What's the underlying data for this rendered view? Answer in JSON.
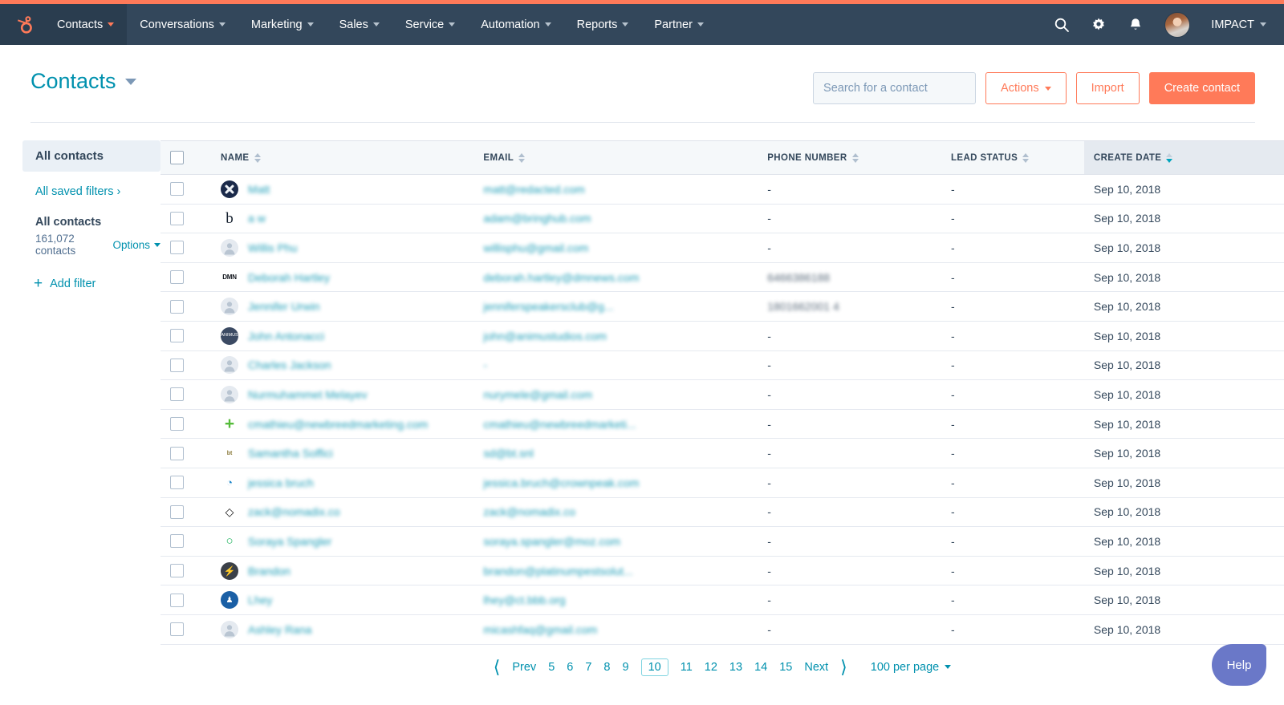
{
  "brand": {
    "accent": "#ff7a59",
    "nav_bg": "#33475b",
    "link": "#0091ae",
    "help_bg": "#6a78c8"
  },
  "nav": {
    "logo": "hubspot-logo",
    "items": [
      {
        "label": "Contacts",
        "active": true
      },
      {
        "label": "Conversations",
        "active": false
      },
      {
        "label": "Marketing",
        "active": false
      },
      {
        "label": "Sales",
        "active": false
      },
      {
        "label": "Service",
        "active": false
      },
      {
        "label": "Automation",
        "active": false
      },
      {
        "label": "Reports",
        "active": false
      },
      {
        "label": "Partner",
        "active": false
      }
    ],
    "icons": [
      "search-icon",
      "gear-icon",
      "bell-icon"
    ],
    "account": "IMPACT"
  },
  "header": {
    "title": "Contacts",
    "search": {
      "value": "",
      "placeholder": "Search for a contact"
    },
    "actions_label": "Actions",
    "import_label": "Import",
    "create_label": "Create contact"
  },
  "sidebar": {
    "tab": "All contacts",
    "saved_filters": "All saved filters",
    "group_title": "All contacts",
    "contact_count": "161,072 contacts",
    "options_label": "Options",
    "add_filter": "Add filter"
  },
  "table": {
    "columns": [
      {
        "label": "NAME",
        "sorted": false
      },
      {
        "label": "EMAIL",
        "sorted": false
      },
      {
        "label": "PHONE NUMBER",
        "sorted": false
      },
      {
        "label": "LEAD STATUS",
        "sorted": false
      },
      {
        "label": "CREATE DATE",
        "sorted": true,
        "direction": "desc"
      }
    ],
    "rows": [
      {
        "avatar": "x-logo-icon",
        "name": "Matt",
        "email": "matt@redacted.com",
        "phone": "-",
        "lead_status": "-",
        "create_date": "Sep 10, 2018"
      },
      {
        "avatar": "b-logo-icon",
        "name": "a w",
        "email": "adam@bringhub.com",
        "phone": "-",
        "lead_status": "-",
        "create_date": "Sep 10, 2018"
      },
      {
        "avatar": "default-avatar-icon",
        "name": "Willis Phu",
        "email": "willisphu@gmail.com",
        "phone": "-",
        "lead_status": "-",
        "create_date": "Sep 10, 2018"
      },
      {
        "avatar": "dmn-logo-icon",
        "name": "Deborah Hartley",
        "email": "deborah.hartley@dmnews.com",
        "phone": "6466386188",
        "lead_status": "-",
        "create_date": "Sep 10, 2018"
      },
      {
        "avatar": "default-avatar-icon",
        "name": "Jennifer Urwin",
        "email": "jenniferspeakersclub@g...",
        "phone": "1801662001 4",
        "lead_status": "-",
        "create_date": "Sep 10, 2018"
      },
      {
        "avatar": "animus-logo-icon",
        "name": "John Antonacci",
        "email": "john@animustudios.com",
        "phone": "-",
        "lead_status": "-",
        "create_date": "Sep 10, 2018"
      },
      {
        "avatar": "default-avatar-icon",
        "name": "Charles Jackson",
        "email": "-",
        "phone": "-",
        "lead_status": "-",
        "create_date": "Sep 10, 2018"
      },
      {
        "avatar": "default-avatar-icon",
        "name": "Nurmuhammet Melayev",
        "email": "nurymele@gmail.com",
        "phone": "-",
        "lead_status": "-",
        "create_date": "Sep 10, 2018"
      },
      {
        "avatar": "plus-logo-icon",
        "name": "cmathieu@newbreedmarketing.com",
        "email": "cmathieu@newbreedmarketi...",
        "phone": "-",
        "lead_status": "-",
        "create_date": "Sep 10, 2018"
      },
      {
        "avatar": "bt-logo-icon",
        "name": "Samantha Soffici",
        "email": "sd@bt.snl",
        "phone": "-",
        "lead_status": "-",
        "create_date": "Sep 10, 2018"
      },
      {
        "avatar": "crownpeak-logo-icon",
        "name": "jessica bruch",
        "email": "jessica.bruch@crownpeak.com",
        "phone": "-",
        "lead_status": "-",
        "create_date": "Sep 10, 2018"
      },
      {
        "avatar": "nomadix-logo-icon",
        "name": "zack@nomadix.co",
        "email": "zack@nomadix.co",
        "phone": "-",
        "lead_status": "-",
        "create_date": "Sep 10, 2018"
      },
      {
        "avatar": "moz-logo-icon",
        "name": "Soraya Spangler",
        "email": "soraya.spangler@moz.com",
        "phone": "-",
        "lead_status": "-",
        "create_date": "Sep 10, 2018"
      },
      {
        "avatar": "shield-logo-icon",
        "name": "Brandon",
        "email": "brandon@platinumpestsolut...",
        "phone": "-",
        "lead_status": "-",
        "create_date": "Sep 10, 2018"
      },
      {
        "avatar": "bbb-logo-icon",
        "name": "Lhey",
        "email": "lhey@ct.bbb.org",
        "phone": "-",
        "lead_status": "-",
        "create_date": "Sep 10, 2018"
      },
      {
        "avatar": "default-avatar-icon",
        "name": "Ashley Rana",
        "email": "micashfaq@gmail.com",
        "phone": "-",
        "lead_status": "-",
        "create_date": "Sep 10, 2018"
      }
    ]
  },
  "pagination": {
    "prev_label": "Prev",
    "next_label": "Next",
    "pages": [
      "5",
      "6",
      "7",
      "8",
      "9",
      "10",
      "11",
      "12",
      "13",
      "14",
      "15"
    ],
    "active_page": "10",
    "per_page_label": "100 per page"
  },
  "help": {
    "label": "Help"
  }
}
